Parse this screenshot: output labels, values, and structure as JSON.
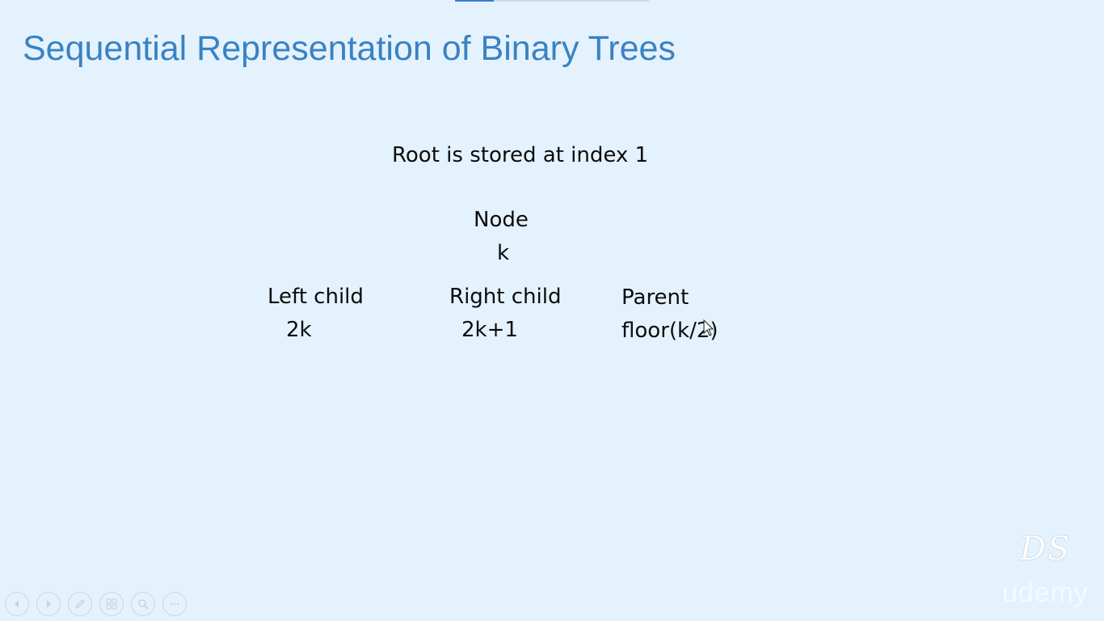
{
  "slide": {
    "title": "Sequential Representation of Binary Trees",
    "root_note": "Root is stored at index 1",
    "node": {
      "label": "Node",
      "index": "k"
    },
    "left_child": {
      "label": "Left child",
      "formula": "2k"
    },
    "right_child": {
      "label": "Right child",
      "formula": "2k+1"
    },
    "parent": {
      "label": "Parent",
      "formula": "floor(k/2)"
    }
  },
  "watermark": {
    "logo_text": "DS",
    "brand": "udemy"
  },
  "controls": {
    "icons": [
      "previous-icon",
      "next-icon",
      "pen-icon",
      "slides-icon",
      "zoom-icon",
      "more-icon"
    ]
  },
  "colors": {
    "background": "#e4f2fd",
    "title": "#3a82c2",
    "body_text": "#0c0c0c"
  }
}
